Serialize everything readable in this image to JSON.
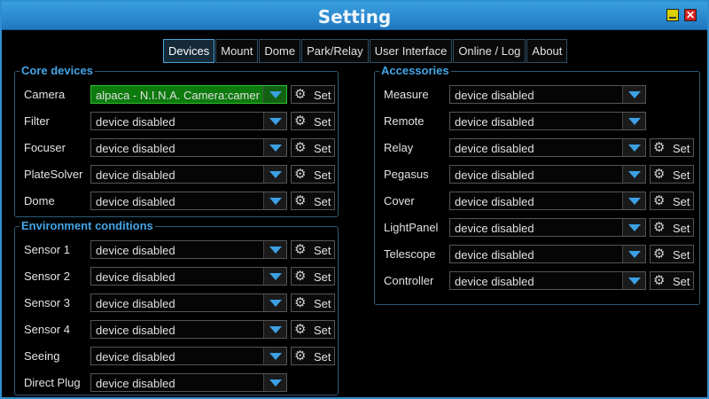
{
  "window": {
    "title": "Setting"
  },
  "tabs": [
    {
      "label": "Devices",
      "active": true
    },
    {
      "label": "Mount"
    },
    {
      "label": "Dome"
    },
    {
      "label": "Park/Relay"
    },
    {
      "label": "User Interface"
    },
    {
      "label": "Online / Log"
    },
    {
      "label": "About"
    }
  ],
  "core": {
    "legend": "Core devices",
    "rows": [
      {
        "label": "Camera",
        "value": "alpaca - N.I.N.A. Camera:camera",
        "set": "Set",
        "connected": true
      },
      {
        "label": "Filter",
        "value": "device disabled",
        "set": "Set"
      },
      {
        "label": "Focuser",
        "value": "device disabled",
        "set": "Set"
      },
      {
        "label": "PlateSolver",
        "value": "device disabled",
        "set": "Set"
      },
      {
        "label": "Dome",
        "value": "device disabled",
        "set": "Set"
      }
    ]
  },
  "env": {
    "legend": "Environment conditions",
    "rows": [
      {
        "label": "Sensor 1",
        "value": "device disabled",
        "set": "Set"
      },
      {
        "label": "Sensor 2",
        "value": "device disabled",
        "set": "Set"
      },
      {
        "label": "Sensor 3",
        "value": "device disabled",
        "set": "Set"
      },
      {
        "label": "Sensor 4",
        "value": "device disabled",
        "set": "Set"
      },
      {
        "label": "Seeing",
        "value": "device disabled",
        "set": "Set"
      },
      {
        "label": "Direct Plug",
        "value": "device disabled"
      }
    ]
  },
  "acc": {
    "legend": "Accessories",
    "rows": [
      {
        "label": "Measure",
        "value": "device disabled"
      },
      {
        "label": "Remote",
        "value": "device disabled"
      },
      {
        "label": "Relay",
        "value": "device disabled",
        "set": "Set"
      },
      {
        "label": "Pegasus",
        "value": "device disabled",
        "set": "Set"
      },
      {
        "label": "Cover",
        "value": "device disabled",
        "set": "Set"
      },
      {
        "label": "LightPanel",
        "value": "device disabled",
        "set": "Set"
      },
      {
        "label": "Telescope",
        "value": "device disabled",
        "set": "Set"
      },
      {
        "label": "Controller",
        "value": "device disabled",
        "set": "Set"
      }
    ]
  },
  "colors": {
    "accent": "#3da0e4",
    "titlebar": "#2b8fd0",
    "connected": "#0d7a0d"
  },
  "icons": {
    "settings": "gear-icon",
    "dropdown": "dropdown-arrow-icon",
    "minimize": "minimize-icon",
    "close": "close-icon"
  }
}
